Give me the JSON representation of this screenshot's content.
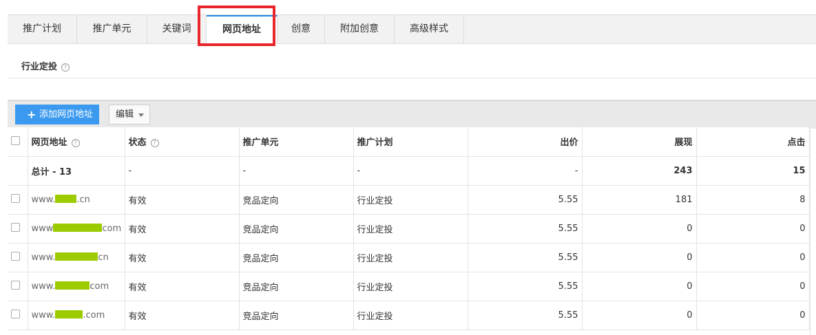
{
  "tabs": [
    {
      "label": "推广计划",
      "active": false
    },
    {
      "label": "推广单元",
      "active": false
    },
    {
      "label": "关键词",
      "active": false
    },
    {
      "label": "网页地址",
      "active": true
    },
    {
      "label": "创意",
      "active": false
    },
    {
      "label": "附加创意",
      "active": false
    },
    {
      "label": "高级样式",
      "active": false
    }
  ],
  "subtitle": "行业定投",
  "toolbar": {
    "add_label": "添加网页地址",
    "edit_label": "编辑"
  },
  "columns": [
    "网页地址",
    "状态",
    "推广单元",
    "推广计划",
    "出价",
    "展现",
    "点击"
  ],
  "total": {
    "label": "总计 - 13",
    "status": "-",
    "unit": "-",
    "plan": "-",
    "bid": "-",
    "impressions": "243",
    "clicks": "15"
  },
  "rows": [
    {
      "url_prefix": "www.",
      "url_suffix": ".cn",
      "status": "有效",
      "unit": "竞品定向",
      "plan": "行业定投",
      "bid": "5.55",
      "impressions": "181",
      "clicks": "8"
    },
    {
      "url_prefix": "www",
      "url_suffix": "com",
      "status": "有效",
      "unit": "竞品定向",
      "plan": "行业定投",
      "bid": "5.55",
      "impressions": "0",
      "clicks": "0"
    },
    {
      "url_prefix": "www.",
      "url_suffix": "cn",
      "status": "有效",
      "unit": "竞品定向",
      "plan": "行业定投",
      "bid": "5.55",
      "impressions": "0",
      "clicks": "0"
    },
    {
      "url_prefix": "www.",
      "url_suffix": "com",
      "status": "有效",
      "unit": "竞品定向",
      "plan": "行业定投",
      "bid": "5.55",
      "impressions": "0",
      "clicks": "0"
    },
    {
      "url_prefix": "www.",
      "url_suffix": ".com",
      "status": "有效",
      "unit": "竞品定向",
      "plan": "行业定投",
      "bid": "5.55",
      "impressions": "0",
      "clicks": "0"
    }
  ],
  "colors": {
    "accent": "#3b9aef",
    "highlight": "#e8262c",
    "redaction": "#9ccc00"
  }
}
